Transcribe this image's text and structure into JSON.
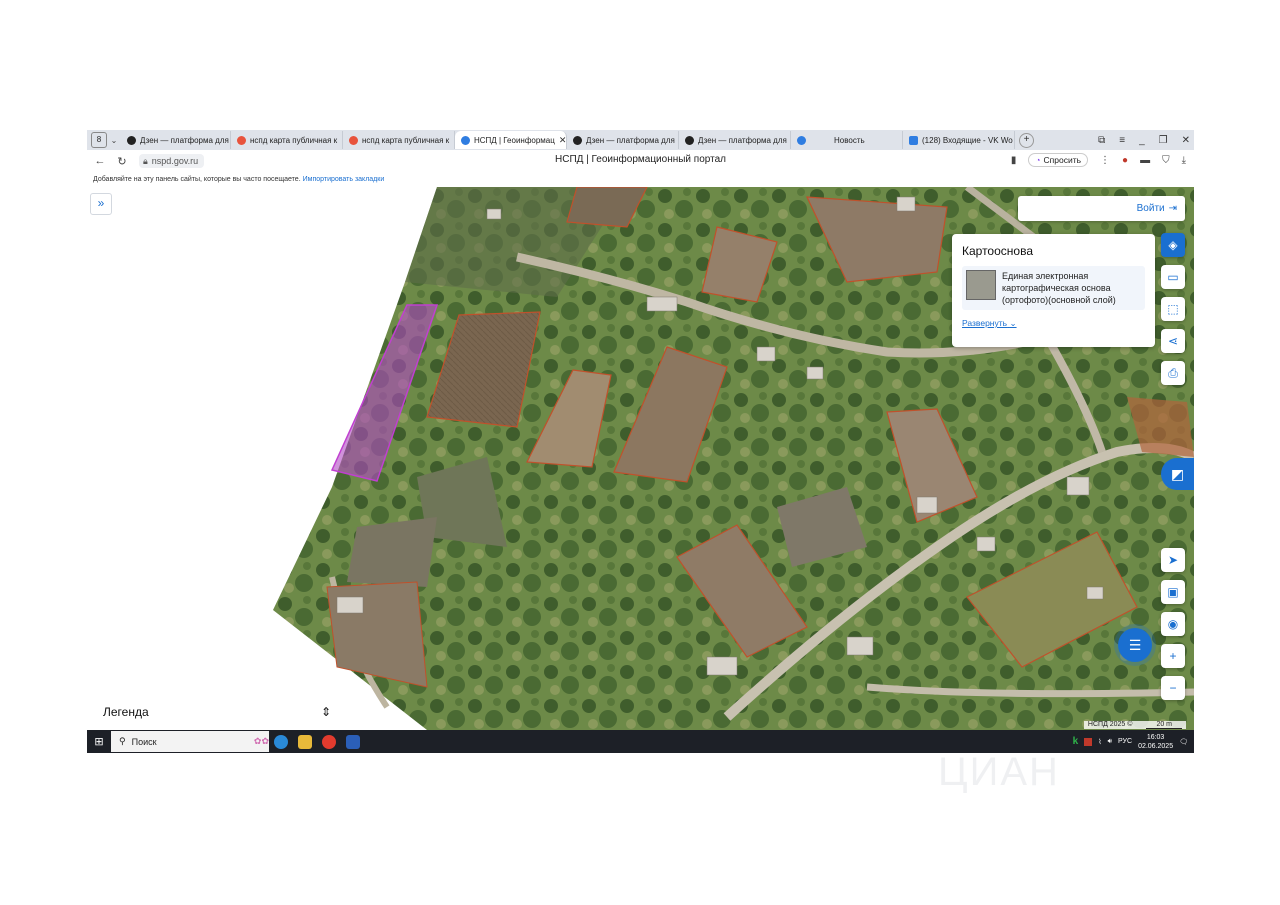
{
  "browser": {
    "tab_counter": "8",
    "tabs": [
      {
        "label": "Дзен — платформа для",
        "color": "#222222"
      },
      {
        "label": "нспд карта публичная к",
        "color": "#e8533c"
      },
      {
        "label": "нспд карта публичная к",
        "color": "#e8533c"
      },
      {
        "label": "НСПД | Геоинформац",
        "color": "#2f7de1",
        "active": true
      },
      {
        "label": "Дзен — платформа для",
        "color": "#222222"
      },
      {
        "label": "Дзен — платформа для",
        "color": "#222222"
      },
      {
        "label": "Новость",
        "color": "#2f7de1"
      },
      {
        "label": "(128) Входящие - VK Wo",
        "color": "#2f7de1"
      }
    ],
    "url": "nspd.gov.ru",
    "page_title": "НСПД | Геоинформационный портал",
    "ask_label": "Спросить",
    "bookmarks_text": "Добавляйте на эту панель сайты, которые вы часто посещаете.",
    "bookmarks_link": "Импортировать закладки"
  },
  "map": {
    "login_label": "Войти",
    "basemap_panel": {
      "title": "Картооснова",
      "layer_name": "Единая электронная картографическая основа (ортофото)(основной слой)",
      "expand_label": "Развернуть"
    },
    "legend_label": "Легенда",
    "copyright": "НСПД 2025 ©",
    "scale_label": "20 m"
  },
  "taskbar": {
    "search_placeholder": "Поиск",
    "lang": "РУС",
    "time": "16:03",
    "date": "02.06.2025"
  },
  "watermark": "ЦИАН"
}
